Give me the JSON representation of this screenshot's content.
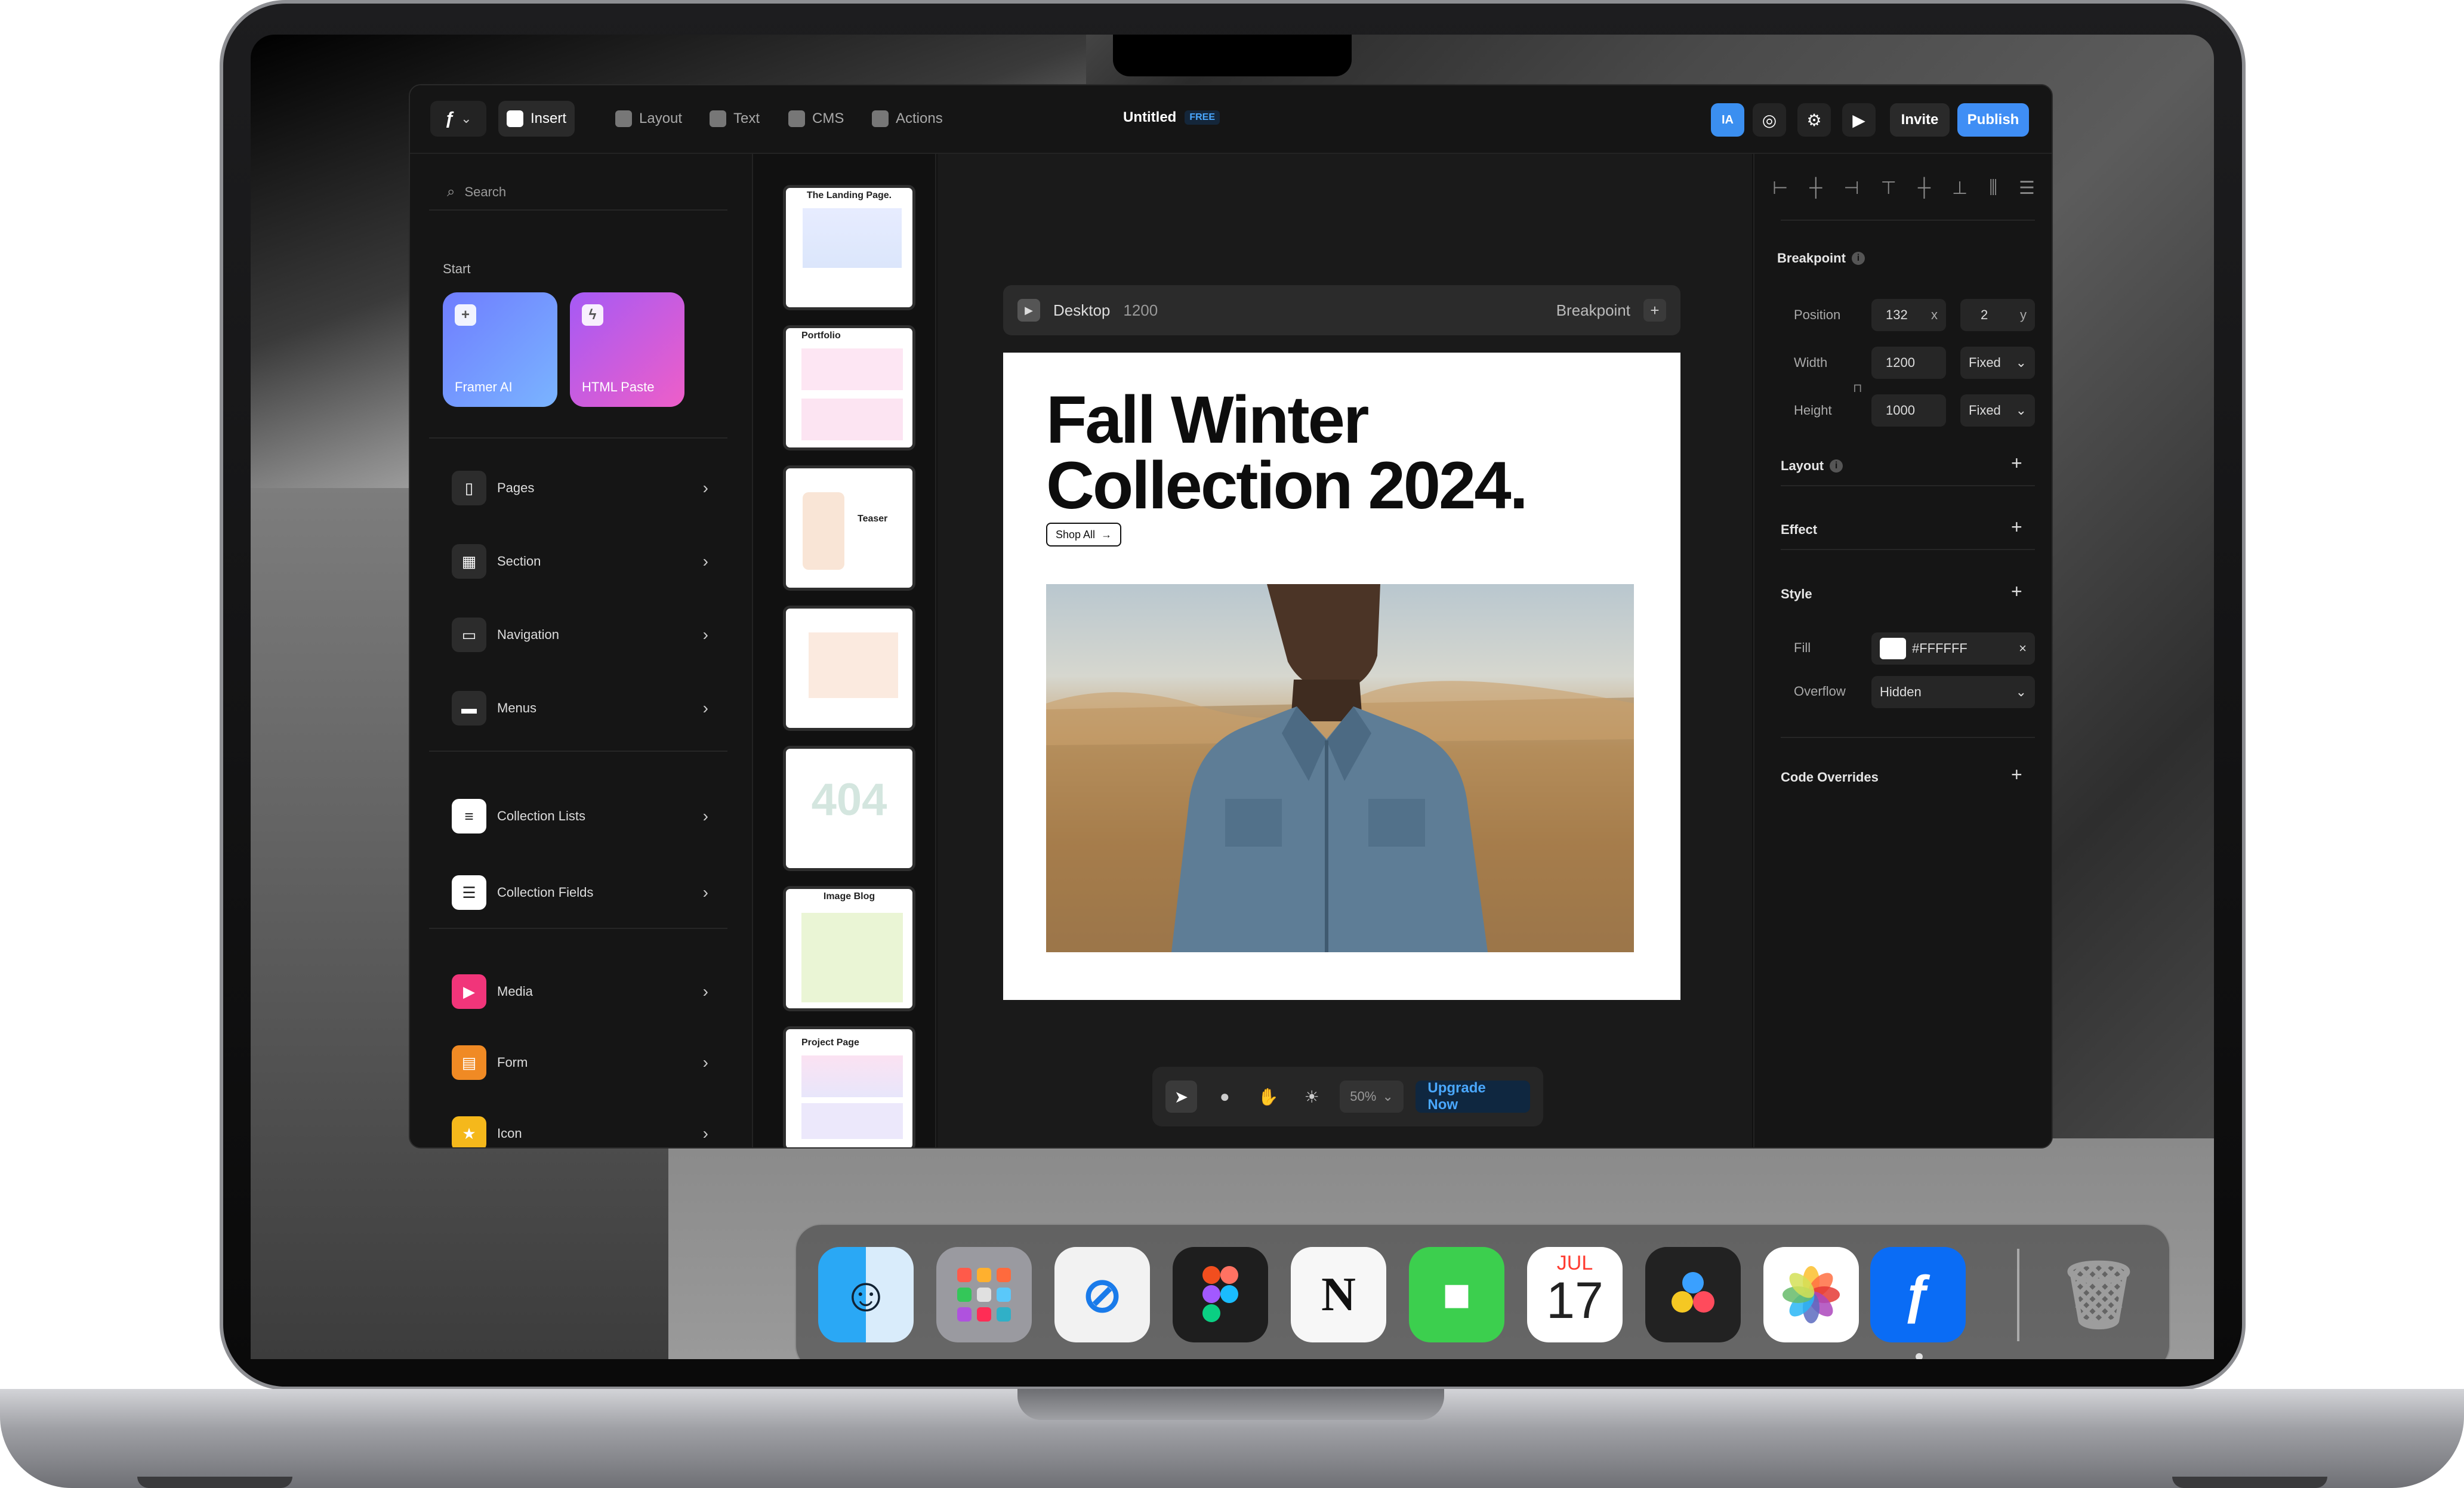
{
  "app": {
    "title": "Untitled",
    "plan_badge": "FREE",
    "user_initials": "IA",
    "invite_label": "Invite",
    "publish_label": "Publish",
    "accent_color": "#3f8ef5"
  },
  "toolbar_tabs": [
    {
      "label": "Insert",
      "icon": "plus-square-icon"
    },
    {
      "label": "Layout",
      "icon": "layout-icon"
    },
    {
      "label": "Text",
      "icon": "text-icon"
    },
    {
      "label": "CMS",
      "icon": "database-icon"
    },
    {
      "label": "Actions",
      "icon": "bolt-icon"
    }
  ],
  "left_panel": {
    "search_placeholder": "Search",
    "start_label": "Start",
    "start_cards": [
      {
        "label": "Framer AI",
        "icon": "sparkle-icon"
      },
      {
        "label": "HTML Paste",
        "icon": "bolt-icon"
      }
    ],
    "items": [
      {
        "label": "Pages"
      },
      {
        "label": "Section"
      },
      {
        "label": "Navigation"
      },
      {
        "label": "Menus"
      },
      {
        "label": "Collection Lists"
      },
      {
        "label": "Collection Fields"
      },
      {
        "label": "Media"
      },
      {
        "label": "Form"
      },
      {
        "label": "Icon"
      }
    ]
  },
  "thumbnails": [
    {
      "title": "The Landing Page."
    },
    {
      "title": "Portfolio"
    },
    {
      "title": "Teaser"
    },
    {
      "title": ""
    },
    {
      "title": "404"
    },
    {
      "title": "Image Blog"
    },
    {
      "title": "Project Page"
    }
  ],
  "canvas": {
    "breakpoint_name": "Desktop",
    "breakpoint_width": "1200",
    "breakpoint_label": "Breakpoint",
    "hero_line1": "Fall Winter",
    "hero_line2": "Collection 2024.",
    "shop_button": "Shop All",
    "zoom": "50%",
    "upgrade_label": "Upgrade Now"
  },
  "right_panel": {
    "breakpoint_heading": "Breakpoint",
    "position_label": "Position",
    "position_x": "132",
    "position_x_unit": "x",
    "position_y": "2",
    "position_y_unit": "y",
    "width_label": "Width",
    "width_value": "1200",
    "width_mode": "Fixed",
    "height_label": "Height",
    "height_value": "1000",
    "height_mode": "Fixed",
    "layout_heading": "Layout",
    "effect_heading": "Effect",
    "style_heading": "Style",
    "fill_label": "Fill",
    "fill_value": "#FFFFFF",
    "overflow_label": "Overflow",
    "overflow_value": "Hidden",
    "code_overrides_heading": "Code Overrides"
  },
  "dock": {
    "apps": [
      "Finder",
      "Launchpad",
      "Safari",
      "Figma",
      "Notion",
      "FaceTime",
      "Calendar",
      "DaVinci Resolve",
      "Photos",
      "Framer"
    ],
    "calendar_month": "JUL",
    "calendar_day": "17",
    "trash": "Trash"
  }
}
